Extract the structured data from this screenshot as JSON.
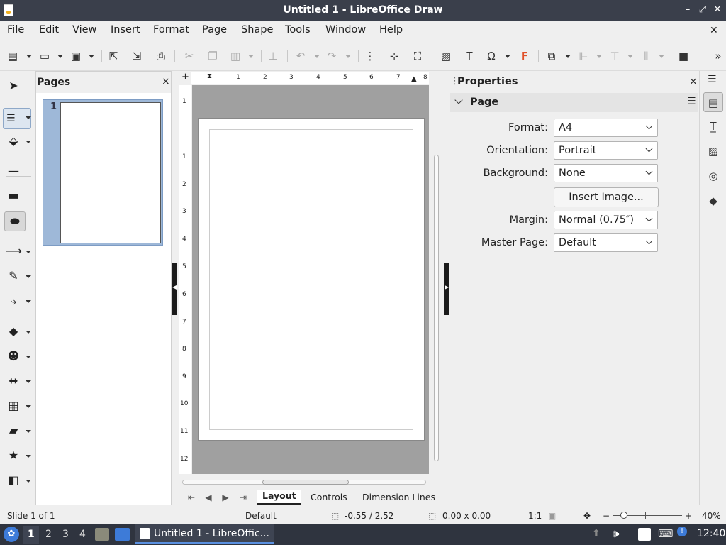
{
  "window": {
    "title": "Untitled 1 - LibreOffice Draw",
    "controls": {
      "minimize": "–",
      "restore": "⤢",
      "close": "✕"
    }
  },
  "menubar": {
    "items": [
      "File",
      "Edit",
      "View",
      "Insert",
      "Format",
      "Page",
      "Shape",
      "Tools",
      "Window",
      "Help"
    ],
    "close_doc": "✕"
  },
  "toolbar": {
    "icons": [
      "new-icon",
      "open-icon",
      "save-icon",
      "export-icon",
      "export-pdf-icon",
      "print-icon",
      "cut-icon",
      "copy-icon",
      "paste-icon",
      "clone-formatting-icon",
      "undo-icon",
      "redo-icon",
      "grid-icon",
      "helplines-icon",
      "zoom-pan-icon",
      "image-icon",
      "textbox-icon",
      "special-character-icon",
      "fontwork-icon",
      "transformations-icon",
      "align-icon",
      "arrange-icon",
      "distribute-icon",
      "shadow-icon",
      "overflow-icon"
    ]
  },
  "pages_pane": {
    "title": "Pages",
    "close": "×",
    "thumbnails": [
      {
        "number": "1"
      }
    ]
  },
  "rulers": {
    "horizontal_ticks": [
      "1",
      "2",
      "3",
      "4",
      "5",
      "6",
      "7",
      "8"
    ],
    "vertical_ticks": [
      "1",
      "1",
      "2",
      "3",
      "4",
      "5",
      "6",
      "7",
      "8",
      "9",
      "10",
      "11",
      "12"
    ]
  },
  "tabs": {
    "items": [
      "Layout",
      "Controls",
      "Dimension Lines"
    ],
    "active": "Layout"
  },
  "sidebar": {
    "title": "Properties",
    "close": "×",
    "section": {
      "title": "Page",
      "format_label": "Format:",
      "format_value": "A4",
      "orientation_label": "Orientation:",
      "orientation_value": "Portrait",
      "background_label": "Background:",
      "background_value": "None",
      "insert_image_label": "Insert Image...",
      "margin_label": "Margin:",
      "margin_value": "Normal (0.75″)",
      "master_page_label": "Master Page:",
      "master_page_value": "Default"
    }
  },
  "statusbar": {
    "slide": "Slide 1 of 1",
    "master": "Default",
    "position": "-0.55 / 2.52",
    "size": "0.00 x 0.00",
    "scale": "1:1",
    "zoom_minus": "−",
    "zoom_plus": "+",
    "zoom": "40%",
    "zoom_level": 0.4
  },
  "taskbar": {
    "workspaces": [
      "1",
      "2",
      "3",
      "4"
    ],
    "active_workspace": "1",
    "task_label": "Untitled 1 - LibreOffic...",
    "clock": "12:40"
  },
  "colors": {
    "titlebar": "#3a3f4b",
    "taskbar": "#2f343f",
    "thumb_selection": "#9eb8d8",
    "workspace": "#a0a0a0"
  }
}
